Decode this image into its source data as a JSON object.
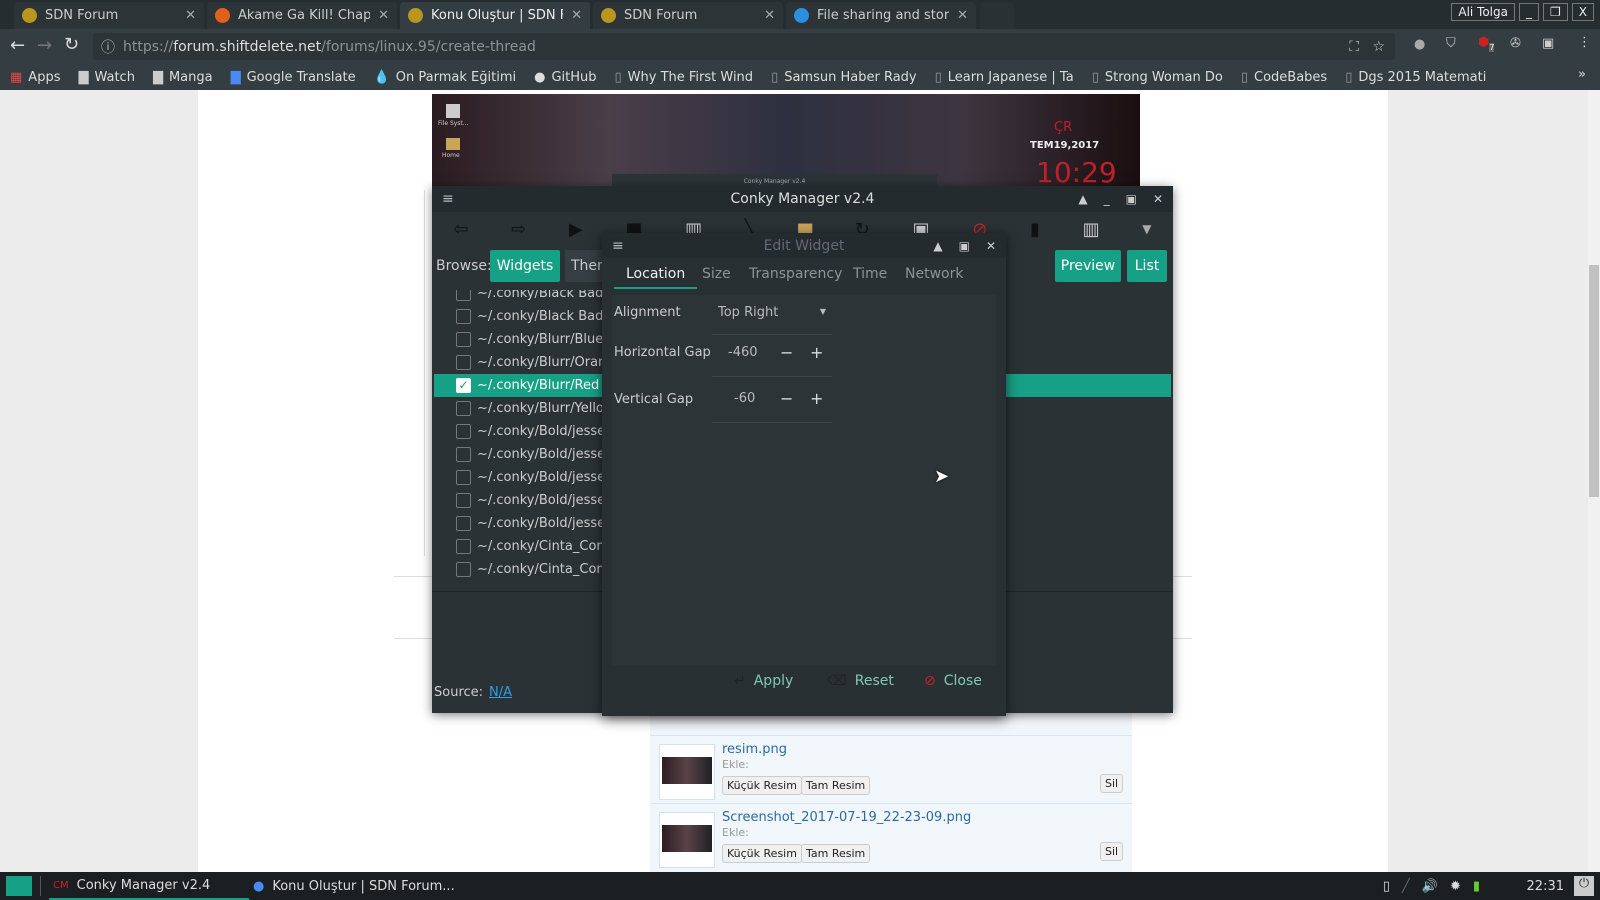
{
  "browser": {
    "tabs": [
      {
        "label": "SDN Forum"
      },
      {
        "label": "Akame Ga Kill! Chapter"
      },
      {
        "label": "Konu Oluştur | SDN Fo",
        "active": true
      },
      {
        "label": "SDN Forum"
      },
      {
        "label": "File sharing and storag"
      }
    ],
    "profile": "Ali Tolga",
    "url_scheme": "https://",
    "url_host": "forum.shiftdelete.net",
    "url_path": "/forums/linux.95/create-thread",
    "bookmarks": [
      "Apps",
      "Watch",
      "Manga",
      "Google Translate",
      "On Parmak Eğitimi",
      "GitHub",
      "Why The First Wind",
      "Samsun Haber Rady",
      "Learn Japanese | Ta",
      "Strong Woman Do",
      "CodeBabes",
      "Dgs 2015 Matemati"
    ],
    "ublock_badge": "7"
  },
  "desktop_preview": {
    "icons": [
      "File Syst...",
      "Home"
    ],
    "clock_day": "ÇR",
    "clock_date": "TEM19,2017",
    "clock_time": "10:29",
    "mini_title": "Conky Manager v2.4"
  },
  "conky": {
    "title": "Conky Manager v2.4",
    "browse_label": "Browse:",
    "browse_widgets": "Widgets",
    "browse_themes": "Themes",
    "preview": "Preview",
    "list": "List",
    "items": [
      {
        "label": "~/.conky/Black Badge/",
        "checked": false
      },
      {
        "label": "~/.conky/Black Badge/",
        "checked": false
      },
      {
        "label": "~/.conky/Blurr/Blue",
        "checked": false
      },
      {
        "label": "~/.conky/Blurr/Orange",
        "checked": false
      },
      {
        "label": "~/.conky/Blurr/Red",
        "checked": true
      },
      {
        "label": "~/.conky/Blurr/Yellow",
        "checked": false
      },
      {
        "label": "~/.conky/Bold/jesse",
        "checked": false
      },
      {
        "label": "~/.conky/Bold/jesse_g",
        "checked": false
      },
      {
        "label": "~/.conky/Bold/jesse_l",
        "checked": false
      },
      {
        "label": "~/.conky/Bold/jesse_p",
        "checked": false
      },
      {
        "label": "~/.conky/Bold/jesse_r",
        "checked": false
      },
      {
        "label": "~/.conky/Cinta_Conky",
        "checked": false
      },
      {
        "label": "~/.conky/Cinta_Conky",
        "checked": false
      }
    ],
    "source_label": "Source:",
    "source_value": "N/A",
    "accent": "#16a085"
  },
  "edit": {
    "title": "Edit Widget",
    "tabs": [
      "Location",
      "Size",
      "Transparency",
      "Time",
      "Network"
    ],
    "alignment_label": "Alignment",
    "alignment_value": "Top Right",
    "hgap_label": "Horizontal Gap",
    "hgap_value": "-460",
    "vgap_label": "Vertical Gap",
    "vgap_value": "-60",
    "apply": "Apply",
    "reset": "Reset",
    "close": "Close"
  },
  "attachments": {
    "items": [
      {
        "name": "resim.png"
      },
      {
        "name": "Screenshot_2017-07-19_22-23-09.png"
      }
    ],
    "insert_label": "Ekle:",
    "thumb": "Küçük Resim",
    "full": "Tam Resim",
    "delete": "Sil"
  },
  "taskbar": {
    "apps": [
      "Conky Manager v2.4",
      "Konu Oluştur | SDN Forum..."
    ],
    "clock": "22:31"
  }
}
